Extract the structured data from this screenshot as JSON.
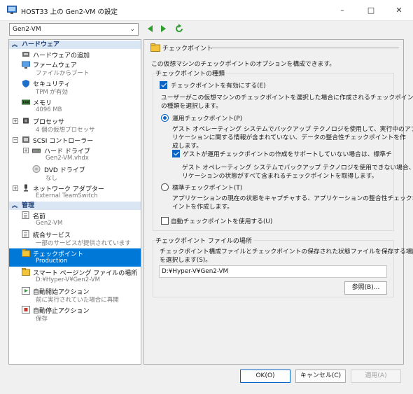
{
  "window": {
    "title": "HOST33 上の Gen2-VM の設定",
    "controls": [
      "–",
      "□",
      "✕"
    ]
  },
  "toolbar": {
    "vm_select_value": "Gen2-VM"
  },
  "sidebar": {
    "hardware_header": "ハードウェア",
    "management_header": "管理",
    "hardware_items": [
      {
        "label": "ハードウェアの追加",
        "sub": ""
      },
      {
        "label": "ファームウェア",
        "sub": "ファイルからブート"
      },
      {
        "label": "セキュリティ",
        "sub": "TPM が有効"
      },
      {
        "label": "メモリ",
        "sub": "4096 MB"
      },
      {
        "label": "プロセッサ",
        "sub": "4 個の仮想プロセッサ"
      },
      {
        "label": "SCSI コントローラー",
        "sub": ""
      },
      {
        "label": "ハード ドライブ",
        "sub": "Gen2-VM.vhdx"
      },
      {
        "label": "DVD ドライブ",
        "sub": "なし"
      },
      {
        "label": "ネットワーク アダプター",
        "sub": "External TeamSwitch"
      }
    ],
    "management_items": [
      {
        "label": "名前",
        "sub": "Gen2-VM"
      },
      {
        "label": "統合サービス",
        "sub": "一部のサービスが提供されています"
      },
      {
        "label": "チェックポイント",
        "sub": "Production"
      },
      {
        "label": "スマート ページング ファイルの場所",
        "sub": "D:¥Hyper-V¥Gen2-VM"
      },
      {
        "label": "自動開始アクション",
        "sub": "前に実行されていた場合に再開"
      },
      {
        "label": "自動停止アクション",
        "sub": "保存"
      }
    ]
  },
  "panel": {
    "header": "チェックポイント",
    "description": "この仮想マシンのチェックポイントのオプションを構成できます。",
    "type_group_label": "チェックポイントの種類",
    "enable_checkbox_label": "チェックポイントを有効にする(E)",
    "choose_text_1": "ユーザーがこの仮想マシンのチェックポイントを選択した場合に作成されるチェックポイント",
    "choose_text_2": "の種類を選択します。",
    "production_label": "運用チェックポイント(P)",
    "production_desc_1": "ゲスト オペレーティング システムでバックアップ テクノロジを使用して、実行中のアプ",
    "production_desc_2": "リケーションに関する情報が含まれていない、データの整合性チェックポイントを作",
    "production_desc_3": "成します。",
    "fallback_label": "ゲストが運用チェックポイントの作成をサポートしていない場合は、標準チェックポイ",
    "fallback_desc_1": "ゲスト オペレーティング システムでバックアップ テクノロジを使用できない場合、アプ",
    "fallback_desc_2": "リケーションの状態がすべて含まれるチェックポイントを取得します。",
    "standard_label": "標準チェックポイント(T)",
    "standard_desc_1": "アプリケーションの現在の状態をキャプチャする、アプリケーションの整合性チェックポ",
    "standard_desc_2": "イントを作成します。",
    "auto_label": "自動チェックポイントを使用する(U)",
    "location_group_label": "チェックポイント ファイルの場所",
    "location_desc_1": "チェックポイント構成ファイルとチェックポイントの保存された状態ファイルを保存する場所",
    "location_desc_2": "を選択します(S)。",
    "location_value": "D:¥Hyper-V¥Gen2-VM",
    "browse_label": "参照(B)..."
  },
  "footer": {
    "ok_label": "OK(O)",
    "cancel_label": "キャンセル(C)",
    "apply_label": "適用(A)"
  },
  "colors": {
    "selection": "#0078d7",
    "section_header_bg": "#dbe6f4",
    "accent": "#0a64c8",
    "nav_green": "#2e9e2e"
  }
}
